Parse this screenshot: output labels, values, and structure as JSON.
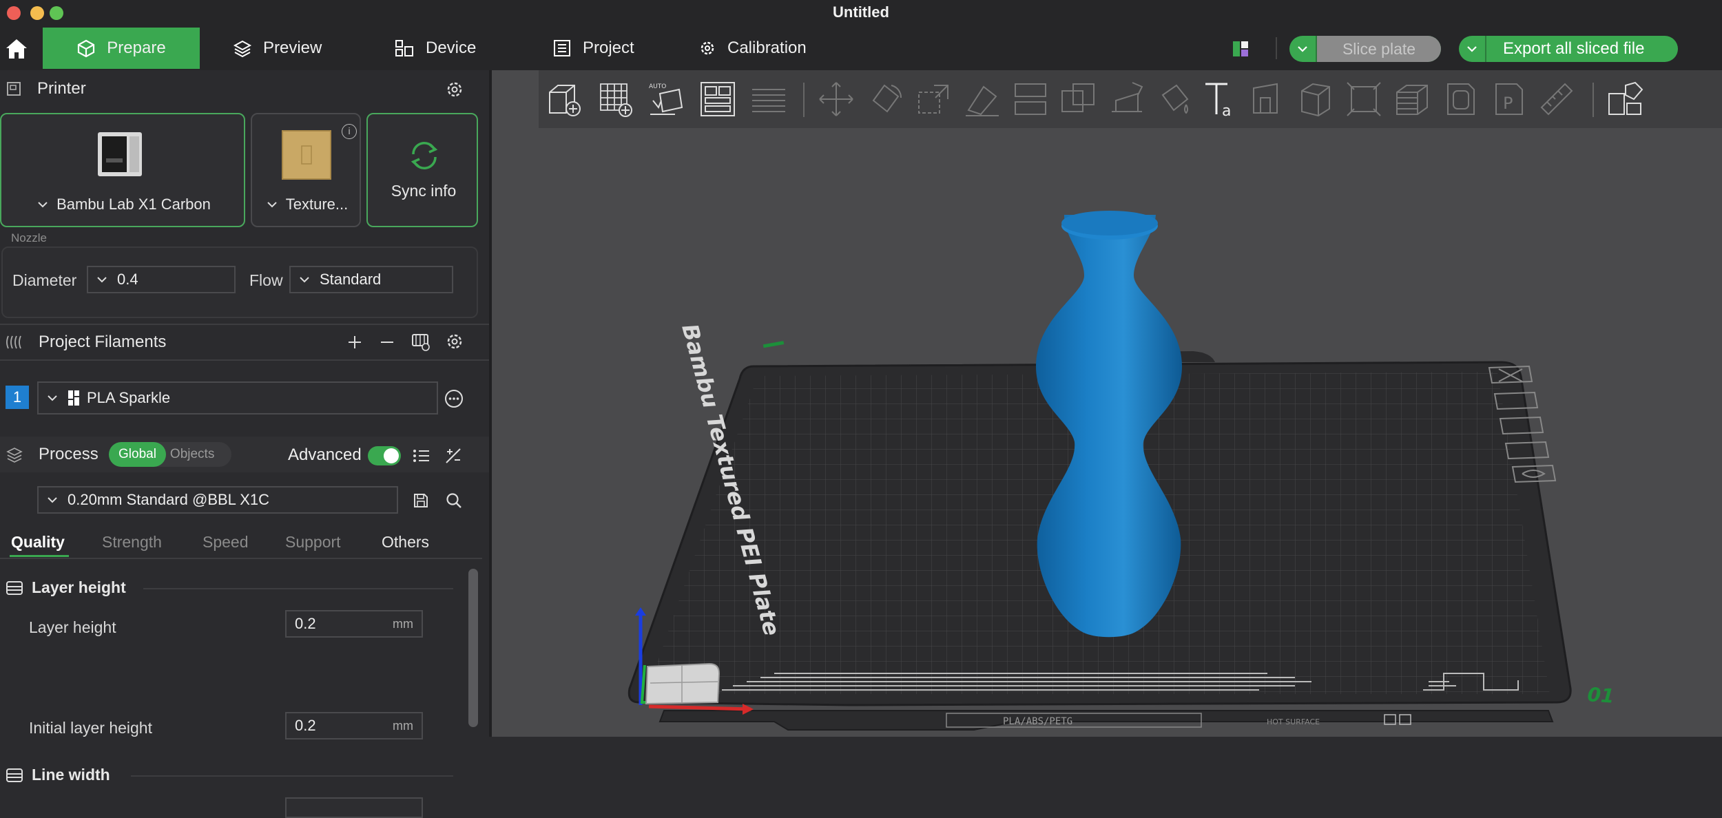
{
  "window": {
    "title": "Untitled"
  },
  "menu": {
    "tabs": [
      {
        "label": "Prepare"
      },
      {
        "label": "Preview"
      },
      {
        "label": "Device"
      },
      {
        "label": "Project"
      },
      {
        "label": "Calibration"
      }
    ],
    "slice_plate": "Slice plate",
    "export_all": "Export all sliced file"
  },
  "printer": {
    "section_label": "Printer",
    "printer_name": "Bambu Lab X1 Carbon",
    "plate_name": "Texture...",
    "sync_label": "Sync info",
    "nozzle_label": "Nozzle",
    "diameter_label": "Diameter",
    "diameter_value": "0.4",
    "flow_label": "Flow",
    "flow_value": "Standard"
  },
  "filaments": {
    "section_label": "Project Filaments",
    "items": [
      {
        "index": "1",
        "name": "PLA Sparkle"
      }
    ]
  },
  "process": {
    "section_label": "Process",
    "toggle_global": "Global",
    "toggle_objects": "Objects",
    "advanced_label": "Advanced",
    "preset": "0.20mm Standard @BBL X1C",
    "subtabs": [
      "Quality",
      "Strength",
      "Speed",
      "Support",
      "Others"
    ],
    "groups": [
      {
        "title": "Layer height",
        "rows": [
          {
            "label": "Layer height",
            "value": "0.2",
            "unit": "mm"
          },
          {
            "label": "Initial layer height",
            "value": "0.2",
            "unit": "mm"
          }
        ]
      },
      {
        "title": "Line width"
      }
    ]
  },
  "plate": {
    "name_label": "Bambu Textured PEI Plate",
    "material_label": "PLA/ABS/PETG",
    "hot_surface_label": "HOT SURFACE",
    "plate_number": "01"
  },
  "colors": {
    "accent": "#3aa850",
    "model": "#1b7fc6",
    "bed": "#2a2a2c"
  }
}
